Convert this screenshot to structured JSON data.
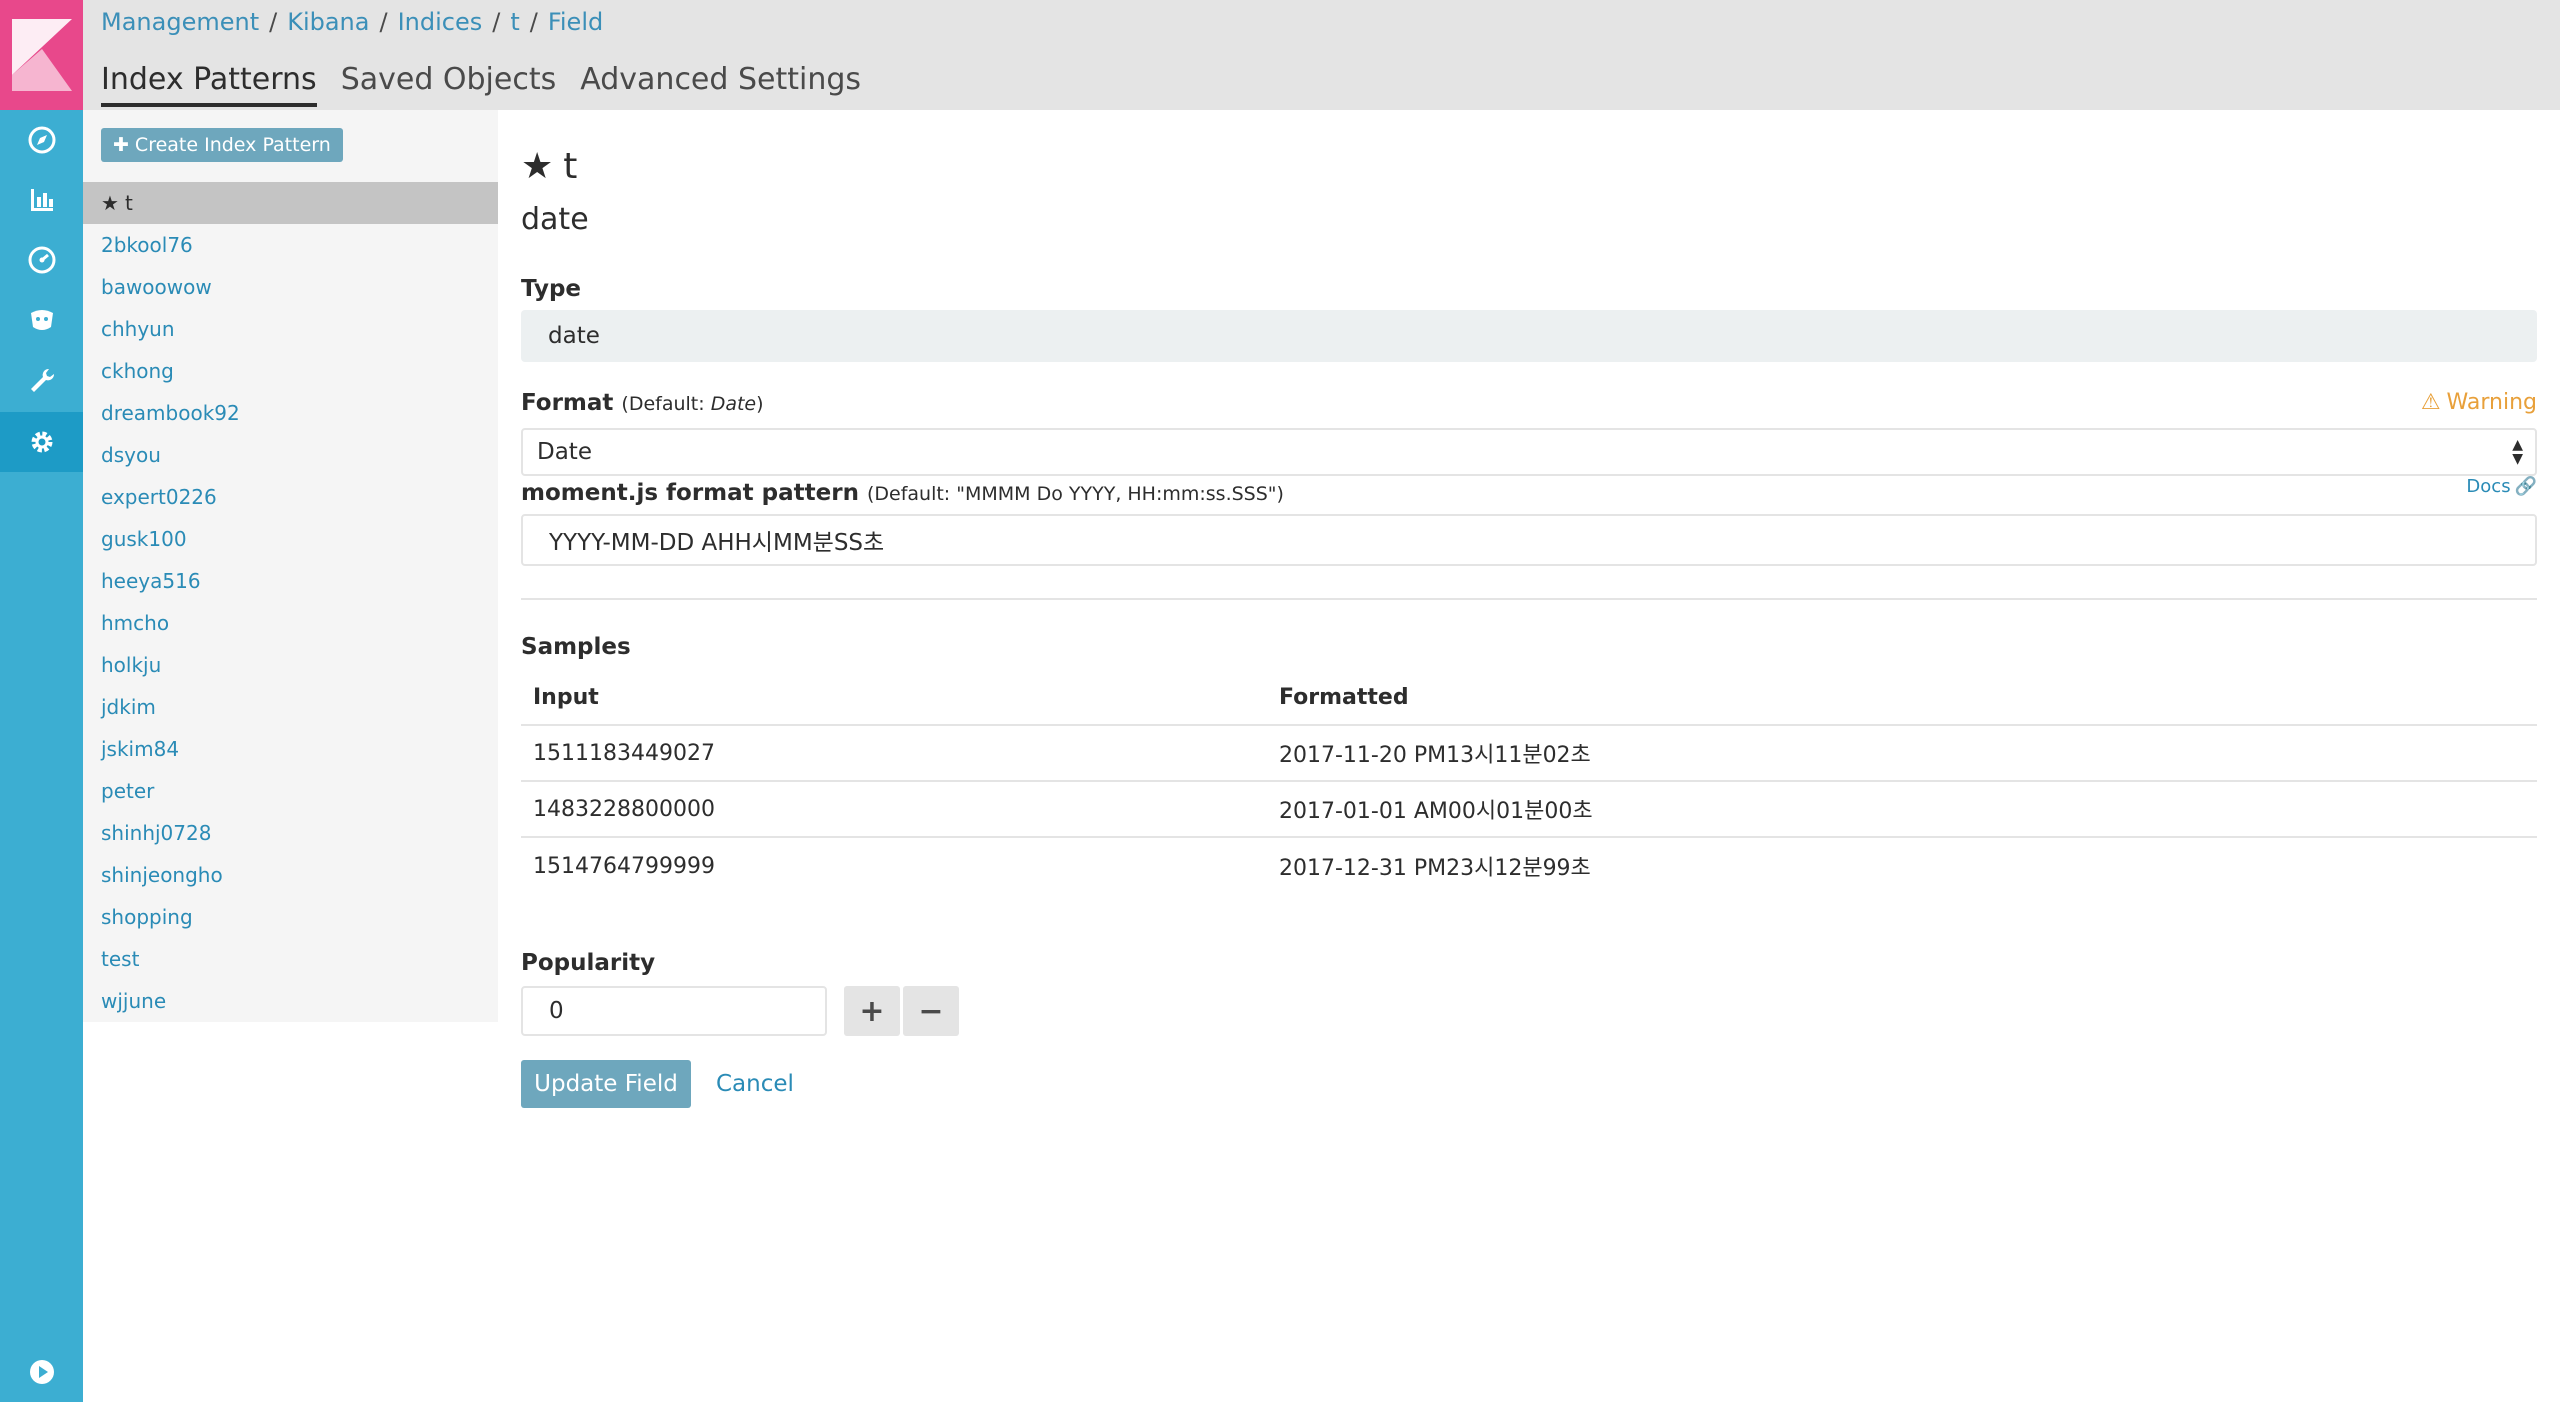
{
  "breadcrumbs": [
    "Management",
    "Kibana",
    "Indices",
    "t",
    "Field"
  ],
  "breadcrumb_separator": "/",
  "tabs": [
    "Index Patterns",
    "Saved Objects",
    "Advanced Settings"
  ],
  "sidebar": {
    "create_button": "Create Index Pattern",
    "patterns": [
      "t",
      "2bkool76",
      "bawoowow",
      "chhyun",
      "ckhong",
      "dreambook92",
      "dsyou",
      "expert0226",
      "gusk100",
      "heeya516",
      "hmcho",
      "holkju",
      "jdkim",
      "jskim84",
      "peter",
      "shinhj0728",
      "shinjeongho",
      "shopping",
      "test",
      "wjjune"
    ]
  },
  "leftnav_icons": [
    "kibana-logo-icon",
    "discover-icon",
    "visualize-icon",
    "dashboard-icon",
    "timelion-icon",
    "dev-tools-icon",
    "management-icon",
    "collapse-icon"
  ],
  "main": {
    "index_pattern": "t",
    "field_name": "date",
    "type_label": "Type",
    "type_value": "date",
    "format_label": "Format",
    "format_default_prefix": "(Default: ",
    "format_default_value": "Date",
    "format_default_suffix": ")",
    "warning": "Warning",
    "format_selected": "Date",
    "pattern_label": "moment.js format pattern",
    "pattern_default": "(Default: \"MMMM Do YYYY, HH:mm:ss.SSS\")",
    "docs_link": "Docs",
    "pattern_value": "YYYY-MM-DD AHH시MM분SS초",
    "samples_label": "Samples",
    "samples_headers": [
      "Input",
      "Formatted"
    ],
    "samples": [
      {
        "input": "1511183449027",
        "formatted": "2017-11-20 PM13시11분02초"
      },
      {
        "input": "1483228800000",
        "formatted": "2017-01-01 AM00시01분00초"
      },
      {
        "input": "1514764799999",
        "formatted": "2017-12-31 PM23시12분99초"
      }
    ],
    "popularity_label": "Popularity",
    "popularity_value": "0",
    "plus_label": "+",
    "minus_label": "−",
    "update_button": "Update Field",
    "cancel_link": "Cancel"
  },
  "colors": {
    "leftnav": "#3caed2",
    "logo_bg": "#e8488b",
    "link": "#2a8bb6",
    "primary_button": "#6ea7bd",
    "warning": "#e8a03a"
  }
}
